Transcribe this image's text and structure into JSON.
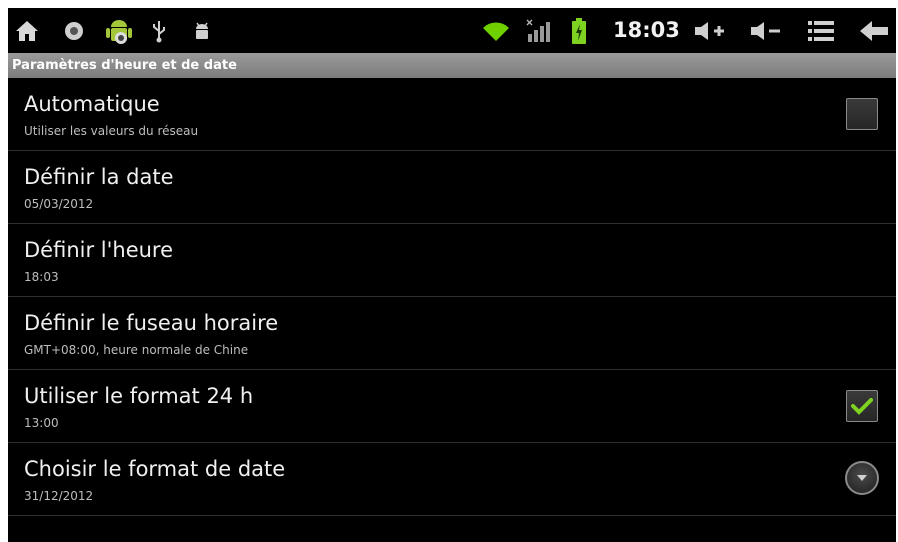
{
  "status_bar": {
    "time": "18:03",
    "icons": [
      "home-icon",
      "notification-dot-icon",
      "android-icon",
      "usb-icon",
      "debug-icon",
      "wifi-icon",
      "signal-icon",
      "battery-charging-icon",
      "volume-up-icon",
      "volume-down-icon",
      "menu-icon",
      "back-icon"
    ]
  },
  "header": {
    "title": "Paramètres d'heure et de date"
  },
  "settings": [
    {
      "title": "Automatique",
      "subtitle": "Utiliser les valeurs du réseau",
      "control": "checkbox",
      "checked": false
    },
    {
      "title": "Définir la date",
      "subtitle": "05/03/2012"
    },
    {
      "title": "Définir l'heure",
      "subtitle": "18:03"
    },
    {
      "title": "Définir le fuseau horaire",
      "subtitle": "GMT+08:00, heure normale de Chine"
    },
    {
      "title": "Utiliser le format 24 h",
      "subtitle": "13:00",
      "control": "checkbox",
      "checked": true
    },
    {
      "title": "Choisir le format de date",
      "subtitle": "31/12/2012",
      "control": "dropdown"
    }
  ],
  "colors": {
    "accent_check": "#7ed321",
    "wifi": "#6fd000",
    "battery": "#7ed321"
  }
}
